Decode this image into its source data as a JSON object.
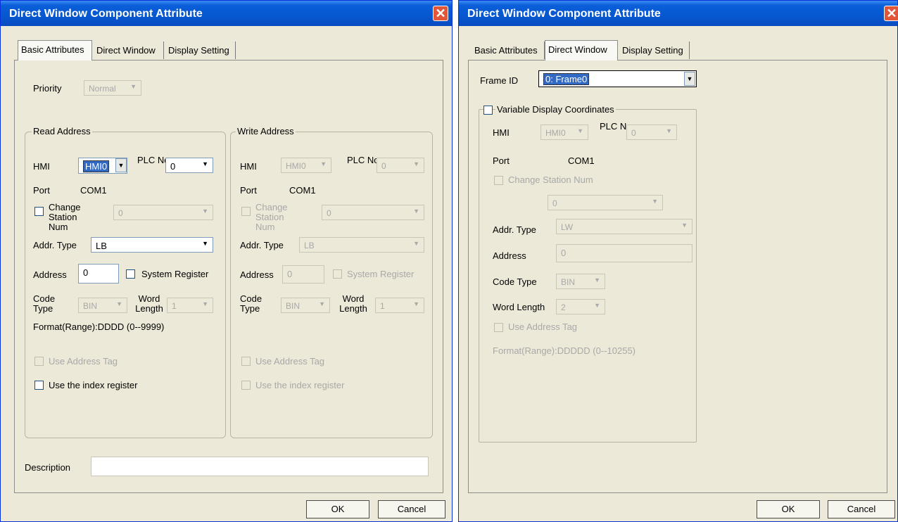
{
  "left_dialog": {
    "title": "Direct Window Component Attribute",
    "tabs": [
      "Basic Attributes",
      "Direct Window",
      "Display Setting"
    ],
    "priority_label": "Priority",
    "priority_value": "Normal",
    "read": {
      "group_label": "Read Address",
      "hmi_label": "HMI",
      "hmi_value": "HMI0",
      "plc_label": "PLC No.",
      "plc_value": "0",
      "port_label": "Port",
      "port_value": "COM1",
      "change_station_label": "Change Station Num",
      "change_station_value": "0",
      "addr_type_label": "Addr. Type",
      "addr_type_value": "LB",
      "address_label": "Address",
      "address_value": "0",
      "system_register_label": "System Register",
      "code_type_label": "Code Type",
      "code_type_value": "BIN",
      "word_length_label": "Word Length",
      "word_length_value": "1",
      "format_text": "Format(Range):DDDD (0--9999)",
      "use_address_tag_label": "Use Address Tag",
      "use_index_register_label": "Use the index register"
    },
    "write": {
      "group_label": "Write Address",
      "hmi_label": "HMI",
      "hmi_value": "HMI0",
      "plc_label": "PLC No.",
      "plc_value": "0",
      "port_label": "Port",
      "port_value": "COM1",
      "change_station_label": "Change Station Num",
      "change_station_value": "0",
      "addr_type_label": "Addr. Type",
      "addr_type_value": "LB",
      "address_label": "Address",
      "address_value": "0",
      "system_register_label": "System Register",
      "code_type_label": "Code Type",
      "code_type_value": "BIN",
      "word_length_label": "Word Length",
      "word_length_value": "1",
      "use_address_tag_label": "Use Address Tag",
      "use_index_register_label": "Use the index register"
    },
    "description_label": "Description",
    "description_value": "",
    "ok_label": "OK",
    "cancel_label": "Cancel"
  },
  "right_dialog": {
    "title": "Direct Window Component Attribute",
    "tabs": [
      "Basic Attributes",
      "Direct Window",
      "Display Setting"
    ],
    "frame_id_label": "Frame ID",
    "frame_id_value": "0: Frame0",
    "variable_coords_label": "Variable Display Coordinates",
    "hmi_label": "HMI",
    "hmi_value": "HMI0",
    "plc_label": "PLC No.",
    "plc_value": "0",
    "port_label": "Port",
    "port_value": "COM1",
    "change_station_label": "Change Station Num",
    "change_station_value": "0",
    "addr_type_label": "Addr. Type",
    "addr_type_value": "LW",
    "address_label": "Address",
    "address_value": "0",
    "code_type_label": "Code Type",
    "code_type_value": "BIN",
    "word_length_label": "Word Length",
    "word_length_value": "2",
    "use_address_tag_label": "Use Address Tag",
    "format_text": "Format(Range):DDDDD (0--10255)",
    "ok_label": "OK",
    "cancel_label": "Cancel"
  },
  "colors": {
    "titlebar": "#0a5fd8",
    "dialog_bg": "#ece9d8",
    "close_button": "#e0573a",
    "selection": "#316ac5",
    "disabled_text": "#a8a8a8"
  },
  "icons": {
    "close": "close-icon",
    "dropdown": "chevron-down-icon"
  }
}
